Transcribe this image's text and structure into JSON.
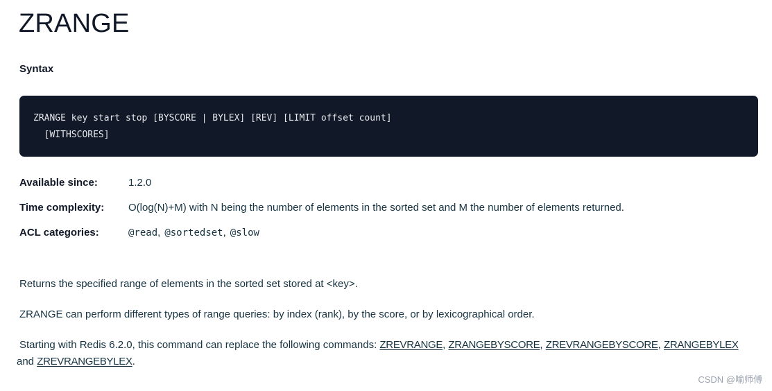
{
  "header": {
    "title": "ZRANGE"
  },
  "syntax": {
    "heading": "Syntax",
    "code_lines": [
      "ZRANGE key start stop [BYSCORE | BYLEX] [REV] [LIMIT offset count]",
      "  [WITHSCORES]"
    ]
  },
  "meta": {
    "available_since": {
      "label": "Available since:",
      "value": "1.2.0"
    },
    "time_complexity": {
      "label": "Time complexity:",
      "value": "O(log(N)+M) with N being the number of elements in the sorted set and M the number of elements returned."
    },
    "acl_categories": {
      "label": "ACL categories:",
      "values": [
        "@read",
        "@sortedset",
        "@slow"
      ],
      "separator": ","
    }
  },
  "description": {
    "p1": "Returns the specified range of elements in the sorted set stored at <key>.",
    "p2": "ZRANGE can perform different types of range queries: by index (rank), by the score, or by lexicographical order.",
    "p3": {
      "prefix": "Starting with Redis 6.2.0, this command can replace the following commands: ",
      "links": [
        "ZREVRANGE",
        "ZRANGEBYSCORE",
        "ZREVRANGEBYSCORE",
        "ZRANGEBYLEX",
        "ZREVRANGEBYLEX"
      ],
      "comma": ", ",
      "and_text": " and ",
      "suffix": "."
    }
  },
  "watermark": {
    "text": "CSDN @喻师傅"
  }
}
